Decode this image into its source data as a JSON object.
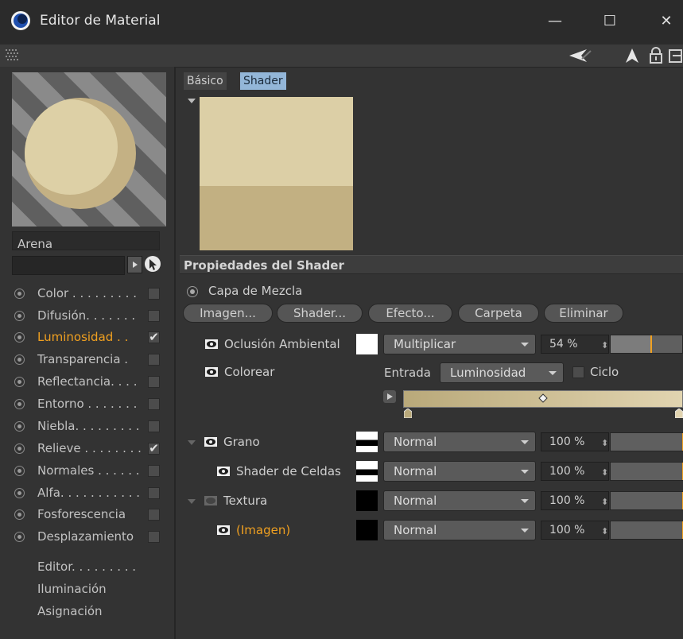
{
  "window": {
    "title": "Editor de Material",
    "minimize_glyph": "—",
    "maximize_glyph": "☐",
    "close_glyph": "✕"
  },
  "material": {
    "name": "Arena",
    "colors": {
      "sand_light": "#dccfa6",
      "sand_mid": "#c2b082",
      "sand_dark": "#9c8a5d"
    }
  },
  "channels": [
    {
      "label": "Color . . . . . . . . .",
      "checked": false,
      "active": false
    },
    {
      "label": "Difusión. . . . . . .",
      "checked": false,
      "active": false
    },
    {
      "label": "Luminosidad . .",
      "checked": true,
      "active": true
    },
    {
      "label": "Transparencia .",
      "checked": false,
      "active": false
    },
    {
      "label": "Reflectancia. . . .",
      "checked": false,
      "active": false
    },
    {
      "label": "Entorno . . . . . . .",
      "checked": false,
      "active": false
    },
    {
      "label": "Niebla. . . . . . . . .",
      "checked": false,
      "active": false
    },
    {
      "label": "Relieve . . . . . . . .",
      "checked": true,
      "active": false
    },
    {
      "label": "Normales . . . . . .",
      "checked": false,
      "active": false
    },
    {
      "label": "Alfa. . . . . . . . . . .",
      "checked": false,
      "active": false
    },
    {
      "label": "Fosforescencia",
      "checked": false,
      "active": false
    },
    {
      "label": "Desplazamiento",
      "checked": false,
      "active": false
    }
  ],
  "nav": {
    "editor": "Editor. . . . . . . . .",
    "illumination": "Iluminación",
    "assignment": "Asignación"
  },
  "tabs": {
    "basic": "Básico",
    "shader": "Shader"
  },
  "section": {
    "title": "Propiedades del Shader",
    "layer_label": "Capa de Mezcla"
  },
  "buttons": {
    "image": "Imagen...",
    "shader": "Shader...",
    "effect": "Efecto...",
    "folder": "Carpeta",
    "delete": "Eliminar"
  },
  "occlusion": {
    "label": "Oclusión Ambiental",
    "mode": "Multiplicar",
    "percent": "54 %",
    "value": 0.54
  },
  "colorize": {
    "label": "Colorear",
    "input_label": "Entrada",
    "input_value": "Luminosidad",
    "cycle_label": "Ciclo"
  },
  "layers": [
    {
      "label": "Grano",
      "mode": "Normal",
      "percent": "100 %"
    },
    {
      "label": "Shader de Celdas",
      "mode": "Normal",
      "percent": "100 %"
    },
    {
      "label": "Textura",
      "mode": "Normal",
      "percent": "100 %"
    },
    {
      "label": "(Imagen)",
      "mode": "Normal",
      "percent": "100 %"
    }
  ],
  "accent_colors": {
    "orange": "#f0a020",
    "tab_blue": "#93b6d8"
  }
}
